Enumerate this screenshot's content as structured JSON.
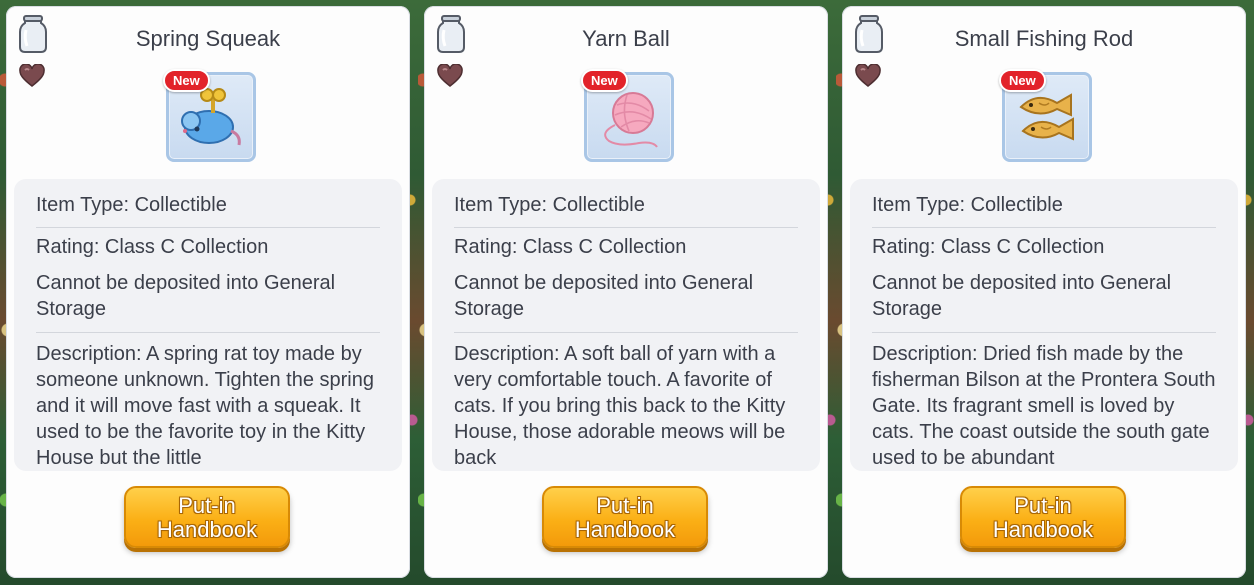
{
  "panels": [
    {
      "title": "Spring Squeak",
      "item_icon": "mouse-toy-icon",
      "new_badge": "New",
      "item_type": "Item Type: Collectible",
      "rating": "Rating: Class C Collection",
      "deposit": "Cannot be deposited into General Storage",
      "description": "Description: A spring rat toy made by someone unknown. Tighten the spring and it will move fast with a squeak. It used to be the favorite toy in the Kitty House but the little",
      "button_line1": "Put-in",
      "button_line2": "Handbook"
    },
    {
      "title": "Yarn Ball",
      "item_icon": "yarn-ball-icon",
      "new_badge": "New",
      "item_type": "Item Type: Collectible",
      "rating": "Rating: Class C Collection",
      "deposit": "Cannot be deposited into General Storage",
      "description": "Description: A soft ball of yarn with a very comfortable touch. A favorite of cats. If you bring this back to the Kitty House, those adorable meows will be back",
      "button_line1": "Put-in",
      "button_line2": "Handbook"
    },
    {
      "title": "Small Fishing Rod",
      "item_icon": "dried-fish-icon",
      "new_badge": "New",
      "item_type": "Item Type: Collectible",
      "rating": "Rating: Class C Collection",
      "deposit": "Cannot be deposited into General Storage",
      "description": "Description: Dried fish made by the fisherman Bilson at the Prontera South Gate. Its fragrant smell is loved by cats. The coast outside the south gate used to be abundant",
      "button_line1": "Put-in",
      "button_line2": "Handbook"
    }
  ],
  "colors": {
    "button_top": "#ffd04a",
    "button_bottom": "#f39a0a",
    "new_badge": "#e2232a",
    "thumb_border": "#a9c6e6",
    "heart": "#7a4a4e"
  }
}
